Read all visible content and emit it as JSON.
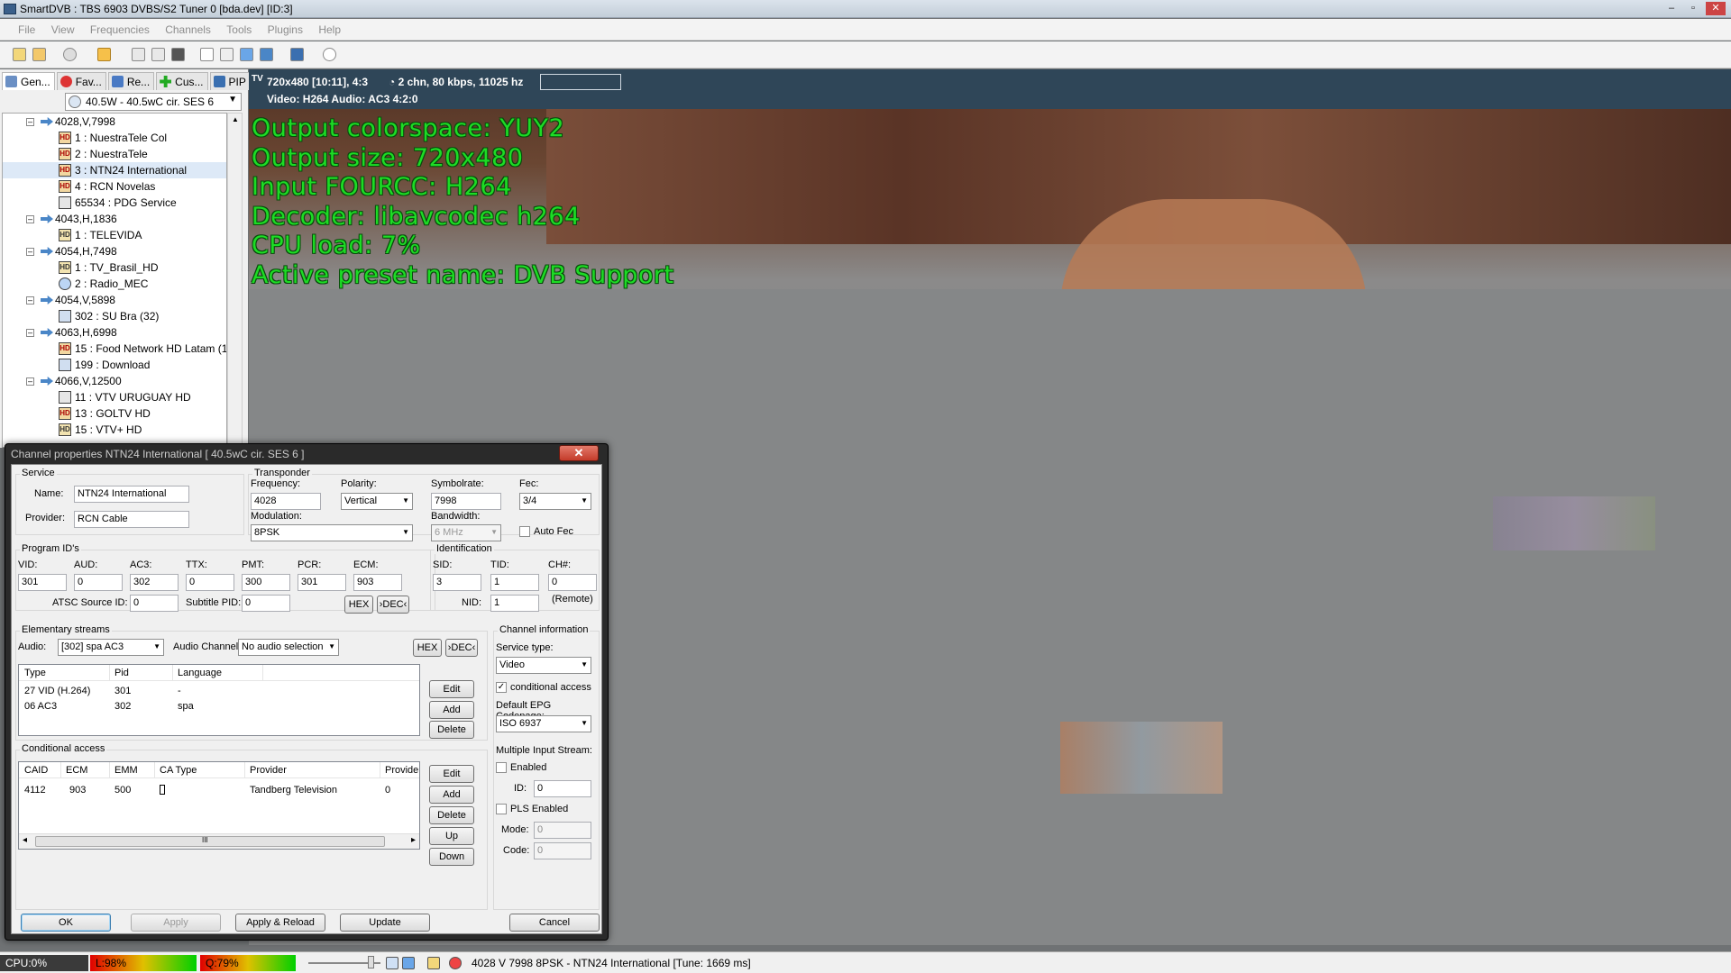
{
  "window": {
    "title": "SmartDVB : TBS 6903 DVBS/S2 Tuner 0 [bda.dev]  [ID:3]",
    "buttons": {
      "minimize": "–",
      "maximize": "▫",
      "close": "✕"
    }
  },
  "menu": [
    "File",
    "View",
    "Frequencies",
    "Channels",
    "Tools",
    "Plugins",
    "Help"
  ],
  "left_panel": {
    "tabs": [
      "Gen...",
      "Fav...",
      "Re...",
      "Cus...",
      "PIP"
    ],
    "satellite": "40.5W -  40.5wC cir. SES 6",
    "tree": [
      {
        "kind": "tp",
        "label": "4028,V,7998"
      },
      {
        "kind": "ch",
        "icon": "hdcas",
        "label": "1 : NuestraTele Col"
      },
      {
        "kind": "ch",
        "icon": "hdcas",
        "label": "2 : NuestraTele"
      },
      {
        "kind": "ch",
        "icon": "hdcas",
        "label": "3 : NTN24 International",
        "selected": true
      },
      {
        "kind": "ch",
        "icon": "hdcas",
        "label": "4 : RCN Novelas"
      },
      {
        "kind": "ch",
        "icon": "data",
        "label": "65534 : PDG Service"
      },
      {
        "kind": "tp",
        "label": "4043,H,1836"
      },
      {
        "kind": "ch",
        "icon": "hd",
        "label": "1 : TELEVIDA"
      },
      {
        "kind": "tp",
        "label": "4054,H,7498"
      },
      {
        "kind": "ch",
        "icon": "hd",
        "label": "1 : TV_Brasil_HD"
      },
      {
        "kind": "ch",
        "icon": "radio",
        "label": "2 : Radio_MEC"
      },
      {
        "kind": "tp",
        "label": "4054,V,5898"
      },
      {
        "kind": "ch",
        "icon": "sd",
        "label": "302 : SU Bra (32)"
      },
      {
        "kind": "tp",
        "label": "4063,H,6998"
      },
      {
        "kind": "ch",
        "icon": "hdcas",
        "label": "15 : Food Network HD Latam (1"
      },
      {
        "kind": "ch",
        "icon": "sd",
        "label": "199 : Download"
      },
      {
        "kind": "tp",
        "label": "4066,V,12500"
      },
      {
        "kind": "ch",
        "icon": "data",
        "label": "11 : VTV URUGUAY HD"
      },
      {
        "kind": "ch",
        "icon": "hdcas",
        "label": "13 : GOLTV HD"
      },
      {
        "kind": "ch",
        "icon": "hd",
        "label": "15 : VTV+ HD"
      }
    ]
  },
  "video": {
    "icon_text": "TV",
    "res": "720x480 [10:11], 4:3",
    "audio": "2 chn, 80 kbps, 11025 hz",
    "codecs": "Video: H264    Audio: AC3    4:2:0",
    "osd": [
      "Output colorspace: YUY2",
      "Output size: 720x480",
      "Input FOURCC: H264",
      "Decoder: libavcodec h264",
      "CPU load: 7%",
      "Active preset name: DVB Support"
    ]
  },
  "dialog": {
    "title": "Channel properties NTN24 International [ 40.5wC cir. SES 6 ]",
    "close": "✕",
    "service": {
      "group": "Service",
      "name_label": "Name:",
      "name": "NTN24 International",
      "provider_label": "Provider:",
      "provider": "RCN Cable"
    },
    "transponder": {
      "group": "Transponder",
      "frequency_label": "Frequency:",
      "frequency": "4028",
      "polarity_label": "Polarity:",
      "polarity": "Vertical",
      "symbolrate_label": "Symbolrate:",
      "symbolrate": "7998",
      "fec_label": "Fec:",
      "fec": "3/4",
      "modulation_label": "Modulation:",
      "modulation": "8PSK",
      "bandwidth_label": "Bandwidth:",
      "bandwidth": "6 MHz",
      "autofec_label": "Auto Fec"
    },
    "pids": {
      "group": "Program ID's",
      "vid_label": "VID:",
      "vid": "301",
      "aud_label": "AUD:",
      "aud": "0",
      "ac3_label": "AC3:",
      "ac3": "302",
      "ttx_label": "TTX:",
      "ttx": "0",
      "pmt_label": "PMT:",
      "pmt": "300",
      "pcr_label": "PCR:",
      "pcr": "301",
      "ecm_label": "ECM:",
      "ecm": "903",
      "atsc_label": "ATSC Source ID:",
      "atsc": "0",
      "subpid_label": "Subtitle PID:",
      "subpid": "0",
      "hex": "HEX",
      "dec": "›DEC‹"
    },
    "ident": {
      "group": "Identification",
      "sid_label": "SID:",
      "sid": "3",
      "tid_label": "TID:",
      "tid": "1",
      "chn_label": "CH#:",
      "chn": "0",
      "remote": "(Remote)",
      "nid_label": "NID:",
      "nid": "1"
    },
    "es": {
      "group": "Elementary streams",
      "audio_label": "Audio:",
      "audio": "[302] spa AC3",
      "channel_label": "Audio Channel:",
      "channel": "No audio selection",
      "hex": "HEX",
      "dec": "›DEC‹",
      "cols": [
        "Type",
        "Pid",
        "Language"
      ],
      "rows": [
        [
          "27 VID (H.264)",
          "301",
          "-"
        ],
        [
          "06 AC3",
          "302",
          "spa"
        ]
      ],
      "edit": "Edit",
      "add": "Add",
      "delete": "Delete"
    },
    "ca": {
      "group": "Conditional access",
      "cols": [
        "CAID",
        "ECM",
        "EMM",
        "CA Type",
        "Provider",
        "Provider"
      ],
      "rows": [
        [
          "4112",
          "903",
          "500",
          "",
          "Tandberg Television",
          "0"
        ]
      ],
      "edit": "Edit",
      "add": "Add",
      "delete": "Delete",
      "up": "Up",
      "down": "Down",
      "scroll_left": "◂",
      "scroll_right": "▸",
      "scroll_grip": "III"
    },
    "chinfo": {
      "group": "Channel information",
      "service_type_label": "Service type:",
      "service_type": "Video",
      "ca_label": "conditional access",
      "epg_label": "Default EPG Codepage:",
      "epg": "ISO 6937",
      "mis_label": "Multiple Input Stream:",
      "enabled_label": "Enabled",
      "id_label": "ID:",
      "id": "0",
      "pls_label": "PLS Enabled",
      "mode_label": "Mode:",
      "mode": "0",
      "code_label": "Code:",
      "code": "0"
    },
    "footer": {
      "ok": "OK",
      "apply": "Apply",
      "apply_reload": "Apply & Reload",
      "update": "Update",
      "cancel": "Cancel"
    }
  },
  "status": {
    "cpu": "CPU:0%",
    "level": "L:98%",
    "quality": "Q:79%",
    "level_value": 98,
    "quality_value": 79,
    "text": "4028 V 7998 8PSK - NTN24 International [Tune: 1669 ms]"
  }
}
